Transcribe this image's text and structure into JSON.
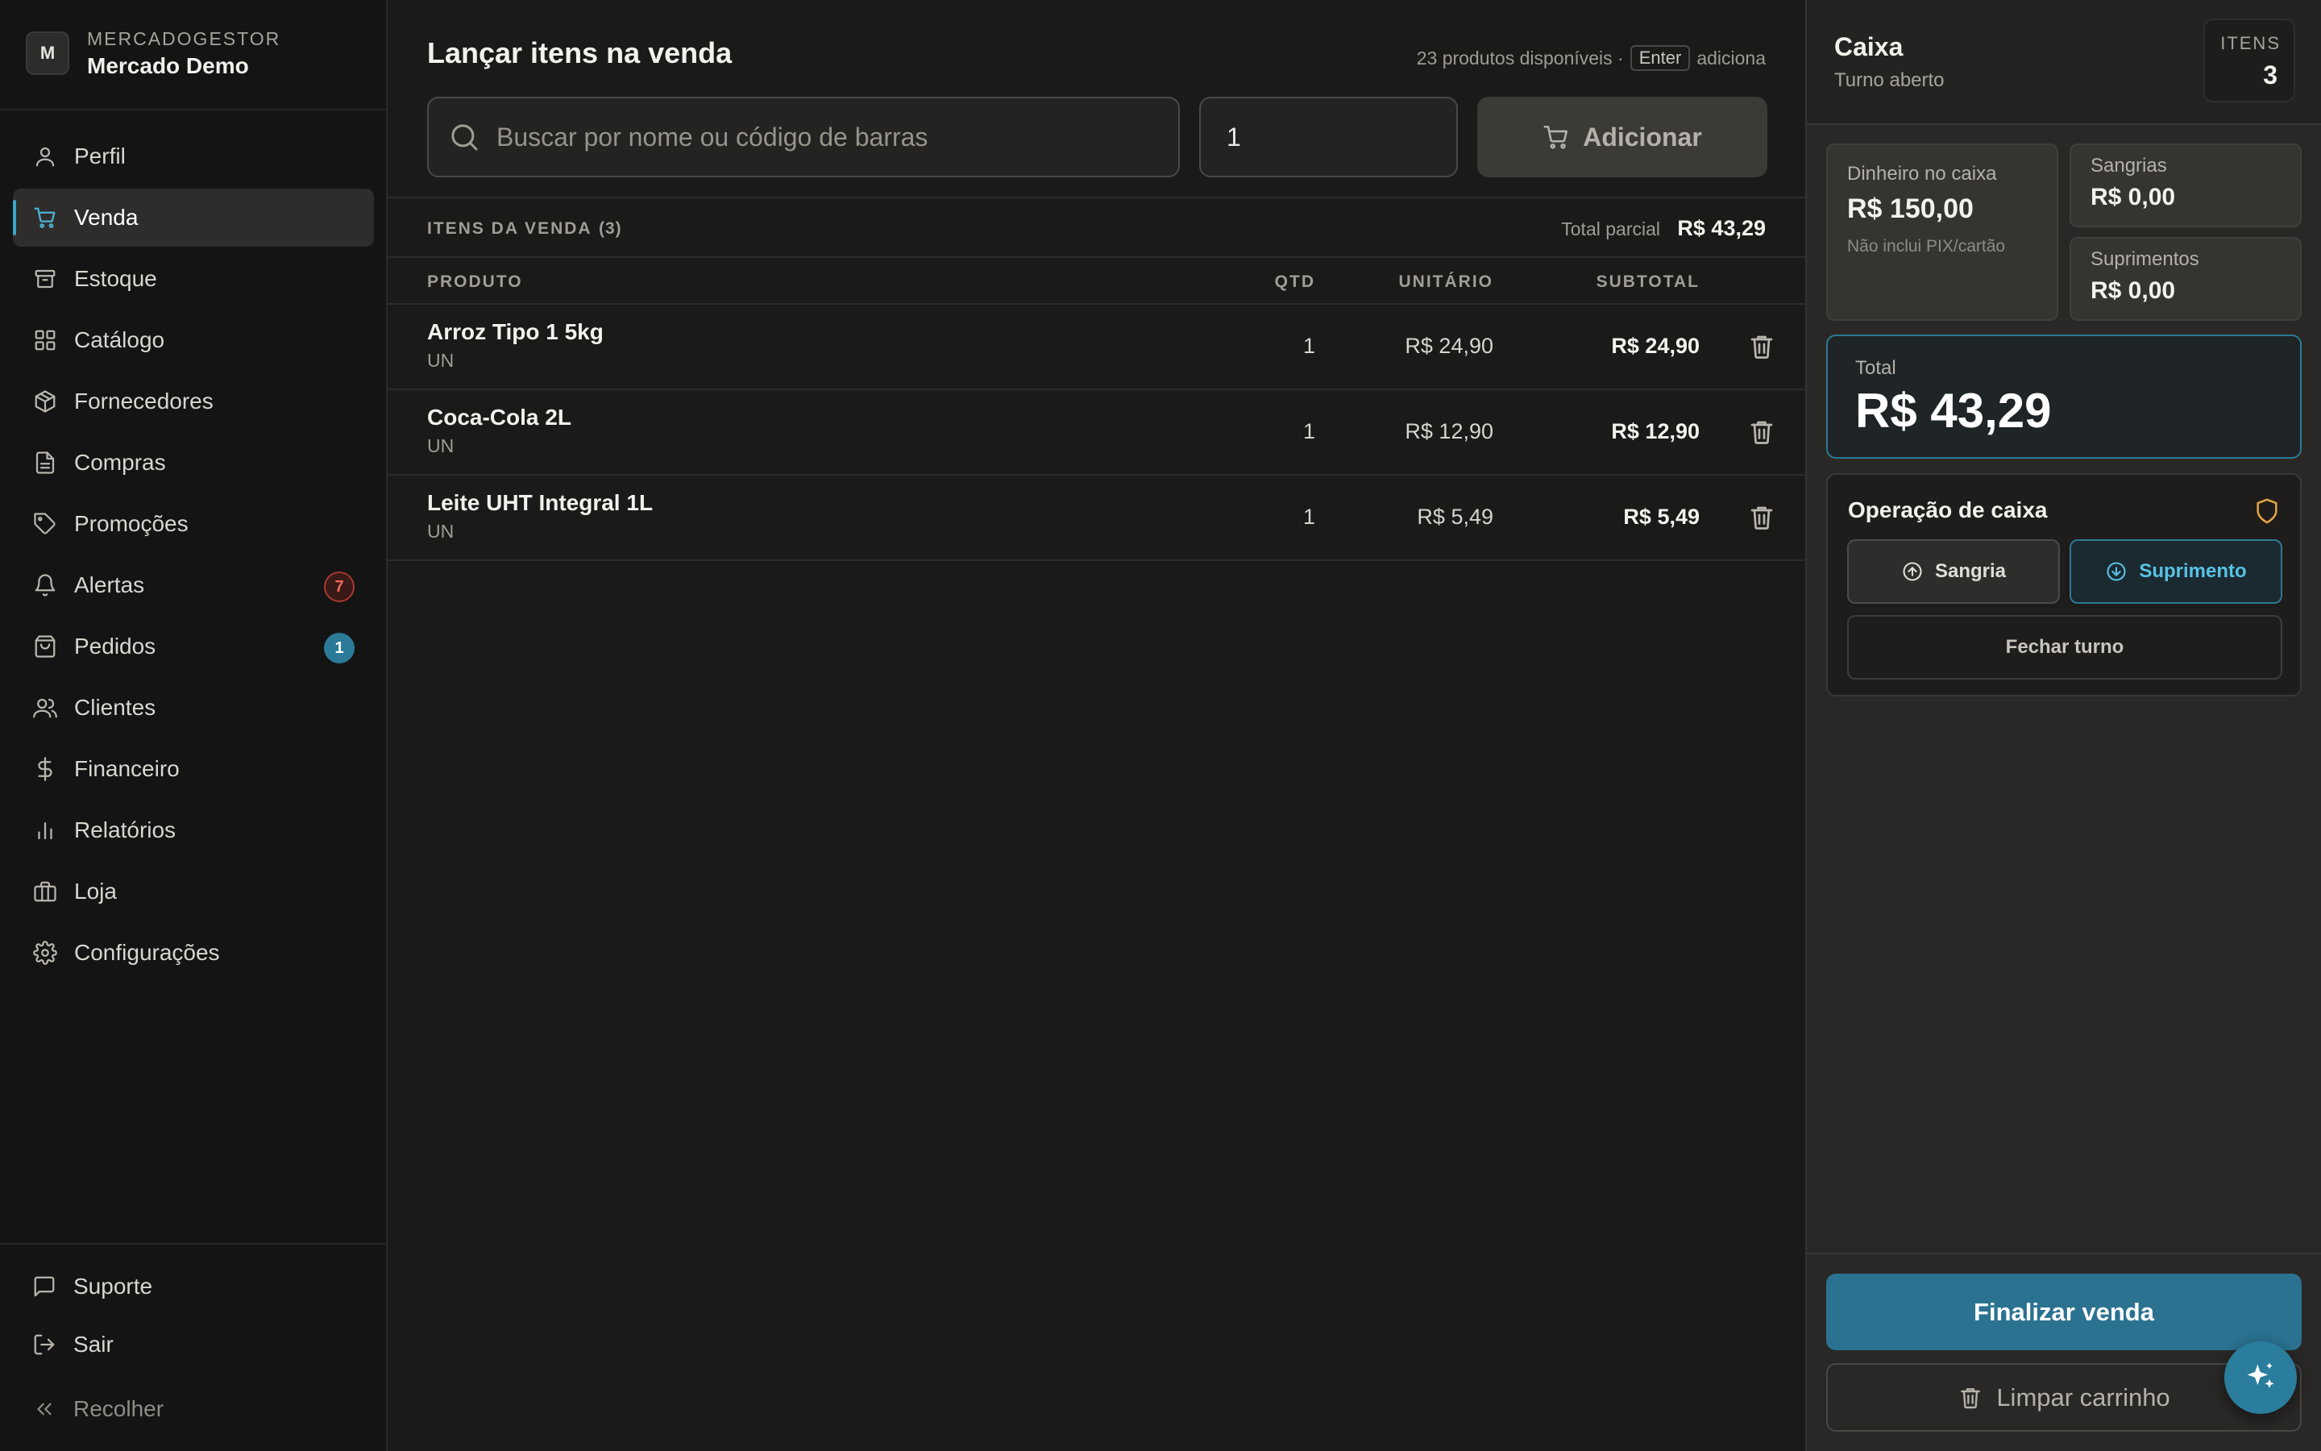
{
  "brand": {
    "initial": "M",
    "kicker": "MERCADOGESTOR",
    "name": "Mercado Demo"
  },
  "sidebar": {
    "items": [
      {
        "label": "Perfil",
        "icon": "user-icon"
      },
      {
        "label": "Venda",
        "icon": "cart-icon",
        "active": true
      },
      {
        "label": "Estoque",
        "icon": "archive-icon"
      },
      {
        "label": "Catálogo",
        "icon": "grid-icon"
      },
      {
        "label": "Fornecedores",
        "icon": "box-icon"
      },
      {
        "label": "Compras",
        "icon": "file-icon"
      },
      {
        "label": "Promoções",
        "icon": "tag-icon"
      },
      {
        "label": "Alertas",
        "icon": "bell-icon",
        "badge": "7"
      },
      {
        "label": "Pedidos",
        "icon": "bag-icon",
        "badge": "1"
      },
      {
        "label": "Clientes",
        "icon": "users-icon"
      },
      {
        "label": "Financeiro",
        "icon": "dollar-icon"
      },
      {
        "label": "Relatórios",
        "icon": "bar-chart-icon"
      },
      {
        "label": "Loja",
        "icon": "briefcase-icon"
      },
      {
        "label": "Configurações",
        "icon": "gear-icon"
      }
    ],
    "footer": {
      "support": "Suporte",
      "logout": "Sair",
      "collapse": "Recolher"
    }
  },
  "main": {
    "title": "Lançar itens na venda",
    "hint": {
      "prefix": "23 produtos disponíveis ·",
      "key": "Enter",
      "suffix": "adiciona"
    },
    "search": {
      "placeholder": "Buscar por nome ou código de barras",
      "value": ""
    },
    "quantity": "1",
    "add_label": "Adicionar",
    "section": {
      "label": "ITENS DA VENDA",
      "count": "(3)",
      "total_label": "Total parcial",
      "total": "R$ 43,29"
    },
    "columns": {
      "product": "PRODUTO",
      "qty": "QTD",
      "unit_price": "UNITÁRIO",
      "subtotal": "SUBTOTAL"
    },
    "items": [
      {
        "name": "Arroz Tipo 1 5kg",
        "unit": "UN",
        "qty": "1",
        "price": "R$ 24,90",
        "subtotal": "R$ 24,90"
      },
      {
        "name": "Coca-Cola 2L",
        "unit": "UN",
        "qty": "1",
        "price": "R$ 12,90",
        "subtotal": "R$ 12,90"
      },
      {
        "name": "Leite UHT Integral 1L",
        "unit": "UN",
        "qty": "1",
        "price": "R$ 5,49",
        "subtotal": "R$ 5,49"
      }
    ]
  },
  "panel": {
    "title": "Caixa",
    "subtitle": "Turno aberto",
    "items_label": "ITENS",
    "items_count": "3",
    "cash": {
      "label": "Dinheiro no caixa",
      "value": "R$ 150,00",
      "note": "Não inclui PIX/cartão"
    },
    "withdrawals": {
      "label": "Sangrias",
      "value": "R$ 0,00"
    },
    "supplies": {
      "label": "Suprimentos",
      "value": "R$ 0,00"
    },
    "total": {
      "label": "Total",
      "value": "R$ 43,29"
    },
    "operation": {
      "title": "Operação de caixa",
      "sangria": "Sangria",
      "suprimento": "Suprimento",
      "close_shift": "Fechar turno"
    },
    "finalize": "Finalizar venda",
    "clear": "Limpar carrinho"
  },
  "colors": {
    "accent": "#2a7290",
    "accent_light": "#58c2e4",
    "alert_red": "#ef6a5b",
    "warning": "#e3a446"
  }
}
